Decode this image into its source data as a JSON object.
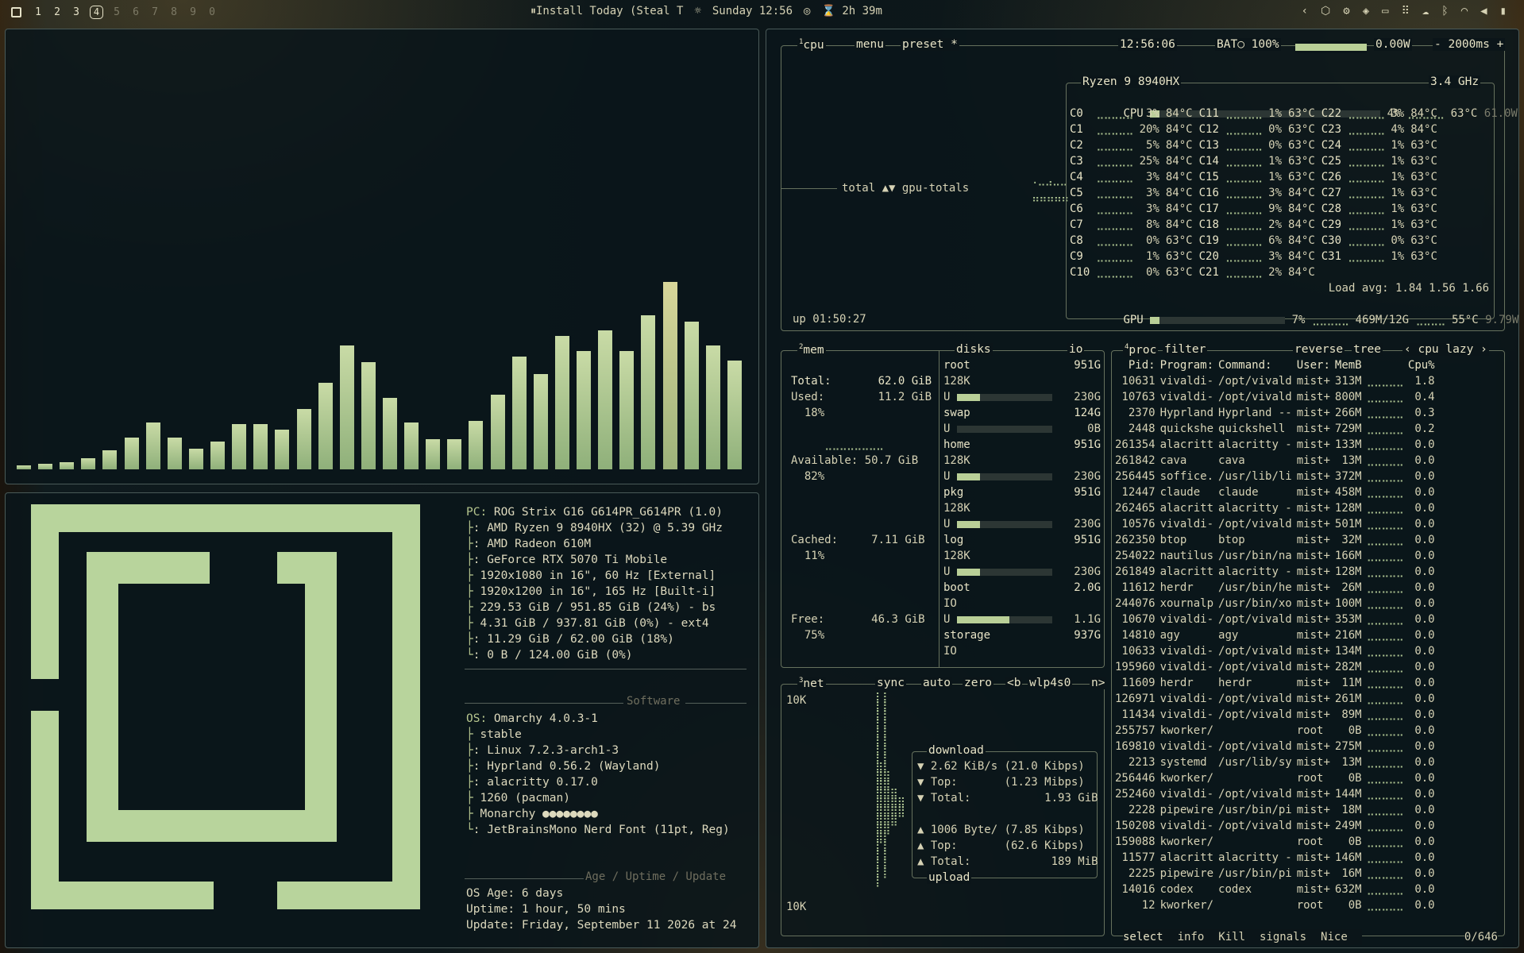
{
  "topbar": {
    "workspaces": [
      "1",
      "2",
      "3",
      "4",
      "5",
      "6",
      "7",
      "8",
      "9",
      "0"
    ],
    "active_workspace": "4",
    "media": "Install Today (Steal T",
    "clock": "Sunday 12:56",
    "timer": "2h 39m",
    "tray_icons": [
      "chevron-left-icon",
      "package-icon",
      "gear-icon",
      "tag-icon",
      "monitor-icon",
      "grid-icon",
      "cloud-icon",
      "bluetooth-icon",
      "wifi-icon",
      "volume-icon",
      "battery-icon"
    ]
  },
  "visualizer": {
    "levels": [
      0.02,
      0.03,
      0.04,
      0.06,
      0.1,
      0.17,
      0.25,
      0.17,
      0.11,
      0.15,
      0.24,
      0.24,
      0.21,
      0.32,
      0.46,
      0.66,
      0.57,
      0.38,
      0.25,
      0.16,
      0.16,
      0.26,
      0.4,
      0.6,
      0.51,
      0.71,
      0.63,
      0.74,
      0.63,
      0.82,
      1.0,
      0.79,
      0.66,
      0.58
    ]
  },
  "fastfetch": {
    "lines": [
      {
        "k": "PC:",
        "v": " ROG Strix G16 G614PR_G614PR (1.0)"
      },
      {
        "k": "├",
        "v": ": AMD Ryzen 9 8940HX (32) @ 5.39 GHz"
      },
      {
        "k": "├",
        "v": ": AMD Radeon 610M"
      },
      {
        "k": "├",
        "v": ": GeForce RTX 5070 Ti Mobile"
      },
      {
        "k": "├",
        "v": " 1920x1080 in 16\", 60 Hz [External]"
      },
      {
        "k": "├",
        "v": " 1920x1200 in 16\", 165 Hz [Built-i]"
      },
      {
        "k": "├",
        "v": " 229.53 GiB / 951.85 GiB (24%) - bs"
      },
      {
        "k": "├",
        "v": " 4.31 GiB / 937.81 GiB (0%) - ext4"
      },
      {
        "k": "├",
        "v": ": 11.29 GiB / 62.00 GiB (18%)"
      },
      {
        "k": "└",
        "v": ": 0 B / 124.00 GiB (0%)"
      }
    ],
    "software_header": "Software",
    "software": [
      {
        "k": "OS:",
        "v": " Omarchy 4.0.3-1"
      },
      {
        "k": "├",
        "v": " stable"
      },
      {
        "k": "├",
        "v": ": Linux 7.2.3-arch1-3"
      },
      {
        "k": "├",
        "v": ": Hyprland 0.56.2 (Wayland)"
      },
      {
        "k": "├",
        "v": ": alacritty 0.17.0"
      },
      {
        "k": "├",
        "v": " 1260 (pacman)"
      },
      {
        "k": "├",
        "v": " Monarchy ●●●●●●●●"
      },
      {
        "k": "└",
        "v": ": JetBrainsMono Nerd Font (11pt, Reg)"
      }
    ],
    "age_header": "Age / Uptime / Update",
    "age": [
      {
        "k": "",
        "v": "OS Age: 6 days"
      },
      {
        "k": "",
        "v": "Uptime: 1 hour, 50 mins"
      },
      {
        "k": "",
        "v": "Update: Friday, September 11 2026 at 24"
      }
    ]
  },
  "btop": {
    "cpu_tabs": [
      "cpu",
      "menu",
      "preset *"
    ],
    "time": "12:56:06",
    "battery": "BAT○ 100%",
    "battery_level": 1.0,
    "power": "0.00W",
    "interval": "2000ms",
    "total_label": "total",
    "gpu_totals": "gpu-totals",
    "uptime": "up 01:50:27",
    "cpu_name": "Ryzen 9 8940HX",
    "cpu_freq": "3.4 GHz",
    "cpu_total": {
      "label": "CPU",
      "pct": "4%",
      "temp": "63°C",
      "power": "61.0W",
      "level": 0.04
    },
    "cores": [
      [
        {
          "n": "C0",
          "p": "3%",
          "t": "84°C"
        },
        {
          "n": "C11",
          "p": "1%",
          "t": "63°C"
        },
        {
          "n": "C22",
          "p": "3%",
          "t": "84°C"
        }
      ],
      [
        {
          "n": "C1",
          "p": "20%",
          "t": "84°C"
        },
        {
          "n": "C12",
          "p": "0%",
          "t": "63°C"
        },
        {
          "n": "C23",
          "p": "4%",
          "t": "84°C"
        }
      ],
      [
        {
          "n": "C2",
          "p": "5%",
          "t": "84°C"
        },
        {
          "n": "C13",
          "p": "0%",
          "t": "63°C"
        },
        {
          "n": "C24",
          "p": "1%",
          "t": "63°C"
        }
      ],
      [
        {
          "n": "C3",
          "p": "25%",
          "t": "84°C"
        },
        {
          "n": "C14",
          "p": "1%",
          "t": "63°C"
        },
        {
          "n": "C25",
          "p": "1%",
          "t": "63°C"
        }
      ],
      [
        {
          "n": "C4",
          "p": "3%",
          "t": "84°C"
        },
        {
          "n": "C15",
          "p": "1%",
          "t": "63°C"
        },
        {
          "n": "C26",
          "p": "1%",
          "t": "63°C"
        }
      ],
      [
        {
          "n": "C5",
          "p": "3%",
          "t": "84°C"
        },
        {
          "n": "C16",
          "p": "3%",
          "t": "84°C"
        },
        {
          "n": "C27",
          "p": "1%",
          "t": "63°C"
        }
      ],
      [
        {
          "n": "C6",
          "p": "3%",
          "t": "84°C"
        },
        {
          "n": "C17",
          "p": "9%",
          "t": "84°C"
        },
        {
          "n": "C28",
          "p": "1%",
          "t": "63°C"
        }
      ],
      [
        {
          "n": "C7",
          "p": "8%",
          "t": "84°C"
        },
        {
          "n": "C18",
          "p": "2%",
          "t": "84°C"
        },
        {
          "n": "C29",
          "p": "1%",
          "t": "63°C"
        }
      ],
      [
        {
          "n": "C8",
          "p": "0%",
          "t": "63°C"
        },
        {
          "n": "C19",
          "p": "6%",
          "t": "84°C"
        },
        {
          "n": "C30",
          "p": "0%",
          "t": "63°C"
        }
      ],
      [
        {
          "n": "C9",
          "p": "1%",
          "t": "63°C"
        },
        {
          "n": "C20",
          "p": "3%",
          "t": "84°C"
        },
        {
          "n": "C31",
          "p": "1%",
          "t": "63°C"
        }
      ],
      [
        {
          "n": "C10",
          "p": "0%",
          "t": "63°C"
        },
        {
          "n": "C21",
          "p": "2%",
          "t": "84°C"
        },
        {
          "n": "",
          "p": "",
          "t": ""
        }
      ]
    ],
    "load_avg": "Load avg: 1.84 1.56 1.66",
    "gpu": {
      "label": "GPU",
      "pct": "7%",
      "mem": "469M/12G",
      "temp": "55°C",
      "power": "9.79W",
      "level": 0.07
    },
    "mem": {
      "title": "mem",
      "total_label": "Total:",
      "total": "62.0 GiB",
      "used_label": "Used:",
      "used": "11.2 GiB",
      "used_pct": "18%",
      "avail_label": "Available:",
      "avail": "50.7 GiB",
      "avail_pct": "82%",
      "cached_label": "Cached:",
      "cached": "7.11 GiB",
      "cached_pct": "11%",
      "free_label": "Free:",
      "free": "46.3 GiB",
      "free_pct": "75%"
    },
    "disks_title": "disks",
    "io_title": "io",
    "disks": [
      {
        "name": "root",
        "size": "951G",
        "r": "128K",
        "u": "230G",
        "level": 0.24
      },
      {
        "name": "swap",
        "size": "124G",
        "r": "",
        "u": "0B",
        "level": 0.0
      },
      {
        "name": "home",
        "size": "951G",
        "r": "128K",
        "u": "230G",
        "level": 0.24
      },
      {
        "name": "pkg",
        "size": "951G",
        "r": "128K",
        "u": "230G",
        "level": 0.24
      },
      {
        "name": "log",
        "size": "951G",
        "r": "128K",
        "u": "230G",
        "level": 0.24
      },
      {
        "name": "boot",
        "size": "2.0G",
        "r": "IO",
        "u": "1.1G",
        "level": 0.55
      },
      {
        "name": "storage",
        "size": "937G",
        "r": "IO",
        "u": "",
        "level": 0.0
      }
    ],
    "net": {
      "title": "net",
      "tabs": [
        "sync",
        "auto",
        "zero"
      ],
      "b": "<b",
      "iface": "wlp4s0",
      "n": "n>",
      "scale_top": "10K",
      "scale_bottom": "10K",
      "download": "download",
      "dl_rate": "2.62 KiB/s (21.0 Kibps)",
      "dl_top": "(1.23 Mibps)",
      "dl_total": "1.93 GiB",
      "upload": "upload",
      "ul_rate": "1006 Byte/ (7.85 Kibps)",
      "ul_top": "(62.6 Kibps)",
      "ul_total": "189 MiB",
      "top_label": "Top:",
      "total_label": "Total:"
    },
    "proc": {
      "title": "proc",
      "filter": "filter",
      "reverse": "reverse",
      "tree": "tree",
      "sort": "cpu lazy",
      "headers": [
        "Pid:",
        "Program:",
        "Command:",
        "User:",
        "MemB",
        "Cpu%"
      ],
      "rows": [
        [
          "10631",
          "vivaldi-",
          "/opt/vivald",
          "mist+",
          "313M",
          "1.8"
        ],
        [
          "10763",
          "vivaldi-",
          "/opt/vivald",
          "mist+",
          "800M",
          "0.4"
        ],
        [
          "2370",
          "Hyprland",
          "Hyprland --",
          "mist+",
          "266M",
          "0.3"
        ],
        [
          "2448",
          "quickshe",
          "quickshell",
          "mist+",
          "729M",
          "0.2"
        ],
        [
          "261354",
          "alacritt",
          "alacritty -",
          "mist+",
          "133M",
          "0.0"
        ],
        [
          "261842",
          "cava",
          "cava",
          "mist+",
          "13M",
          "0.0"
        ],
        [
          "256445",
          "soffice.",
          "/usr/lib/li",
          "mist+",
          "372M",
          "0.0"
        ],
        [
          "12447",
          "claude",
          "claude",
          "mist+",
          "458M",
          "0.0"
        ],
        [
          "262465",
          "alacritt",
          "alacritty -",
          "mist+",
          "128M",
          "0.0"
        ],
        [
          "10576",
          "vivaldi-",
          "/opt/vivald",
          "mist+",
          "501M",
          "0.0"
        ],
        [
          "262350",
          "btop",
          "btop",
          "mist+",
          "32M",
          "0.0"
        ],
        [
          "254022",
          "nautilus",
          "/usr/bin/na",
          "mist+",
          "166M",
          "0.0"
        ],
        [
          "261849",
          "alacritt",
          "alacritty -",
          "mist+",
          "128M",
          "0.0"
        ],
        [
          "11612",
          "herdr",
          "/usr/bin/he",
          "mist+",
          "26M",
          "0.0"
        ],
        [
          "244076",
          "xournalp",
          "/usr/bin/xo",
          "mist+",
          "100M",
          "0.0"
        ],
        [
          "10670",
          "vivaldi-",
          "/opt/vivald",
          "mist+",
          "353M",
          "0.0"
        ],
        [
          "14810",
          "agy",
          "agy",
          "mist+",
          "216M",
          "0.0"
        ],
        [
          "10633",
          "vivaldi-",
          "/opt/vivald",
          "mist+",
          "134M",
          "0.0"
        ],
        [
          "195960",
          "vivaldi-",
          "/opt/vivald",
          "mist+",
          "282M",
          "0.0"
        ],
        [
          "11609",
          "herdr",
          "herdr",
          "mist+",
          "11M",
          "0.0"
        ],
        [
          "126971",
          "vivaldi-",
          "/opt/vivald",
          "mist+",
          "261M",
          "0.0"
        ],
        [
          "11434",
          "vivaldi-",
          "/opt/vivald",
          "mist+",
          "89M",
          "0.0"
        ],
        [
          "255757",
          "kworker/",
          "",
          "root",
          "0B",
          "0.0"
        ],
        [
          "169810",
          "vivaldi-",
          "/opt/vivald",
          "mist+",
          "275M",
          "0.0"
        ],
        [
          "2213",
          "systemd",
          "/usr/lib/sy",
          "mist+",
          "13M",
          "0.0"
        ],
        [
          "256446",
          "kworker/",
          "",
          "root",
          "0B",
          "0.0"
        ],
        [
          "252460",
          "vivaldi-",
          "/opt/vivald",
          "mist+",
          "144M",
          "0.0"
        ],
        [
          "2228",
          "pipewire",
          "/usr/bin/pi",
          "mist+",
          "18M",
          "0.0"
        ],
        [
          "150208",
          "vivaldi-",
          "/opt/vivald",
          "mist+",
          "249M",
          "0.0"
        ],
        [
          "159088",
          "kworker/",
          "",
          "root",
          "0B",
          "0.0"
        ],
        [
          "11577",
          "alacritt",
          "alacritty -",
          "mist+",
          "146M",
          "0.0"
        ],
        [
          "2225",
          "pipewire",
          "/usr/bin/pi",
          "mist+",
          "16M",
          "0.0"
        ],
        [
          "14016",
          "codex",
          "codex",
          "mist+",
          "632M",
          "0.0"
        ],
        [
          "12",
          "kworker/",
          "",
          "root",
          "0B",
          "0.0"
        ]
      ],
      "footer": [
        "select",
        "info",
        "Kill",
        "signals",
        "Nice"
      ],
      "count": "0/646"
    }
  }
}
